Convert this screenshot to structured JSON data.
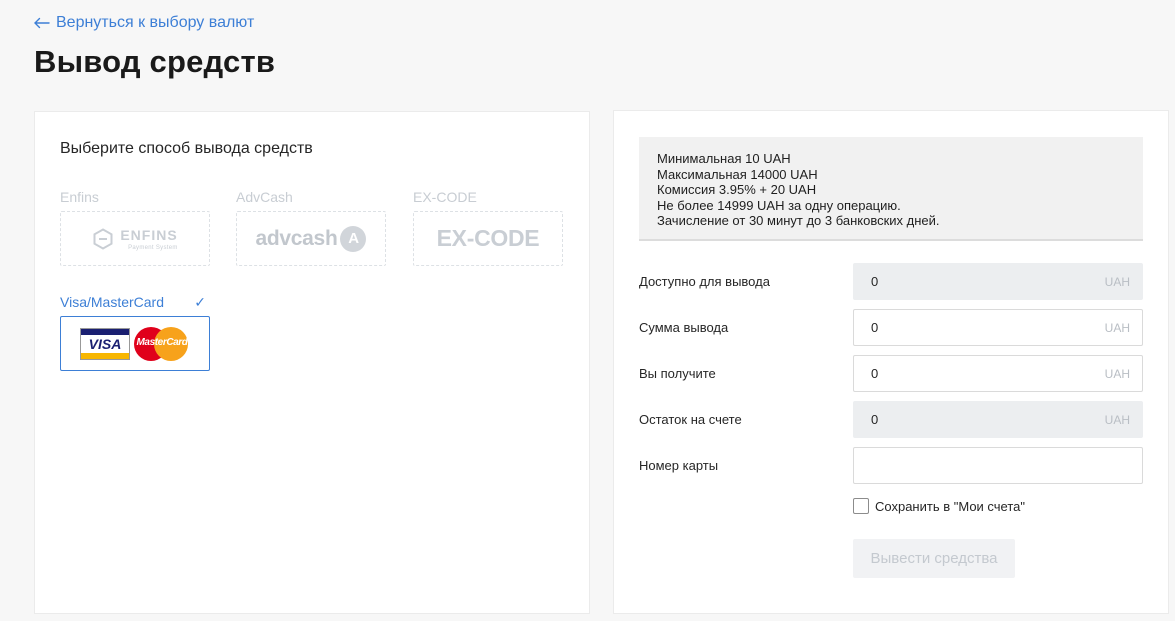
{
  "header": {
    "back_label": "Вернуться к выбору валют",
    "title": "Вывод средств"
  },
  "methods": {
    "heading": "Выберите способ вывода средств",
    "items": [
      {
        "label": "Enfins",
        "logo_text": "ENFINS",
        "logo_sub": "Payment System",
        "selected": false
      },
      {
        "label": "AdvCash",
        "logo_text": "advcash",
        "logo_symbol": "A",
        "selected": false
      },
      {
        "label": "EX-CODE",
        "logo_text": "EX-CODE",
        "selected": false
      },
      {
        "label": "Visa/MasterCard",
        "logo_visa": "VISA",
        "logo_mc": "MasterCard",
        "selected": true
      }
    ]
  },
  "info": {
    "lines": [
      "Минимальная 10 UAH",
      "Максимальная 14000 UAH",
      "Комиссия 3.95% + 20 UAH",
      "Не более 14999 UAH за одну операцию.",
      "Зачисление от 30 минут до 3 банковских дней."
    ]
  },
  "form": {
    "available": {
      "label": "Доступно для вывода",
      "value": "0",
      "currency": "UAH"
    },
    "amount": {
      "label": "Сумма вывода",
      "value": "0",
      "currency": "UAH"
    },
    "receive": {
      "label": "Вы получите",
      "value": "0",
      "currency": "UAH"
    },
    "balance": {
      "label": "Остаток на счете",
      "value": "0",
      "currency": "UAH"
    },
    "card": {
      "label": "Номер карты",
      "value": ""
    },
    "save_label": "Сохранить в \"Мои счета\"",
    "submit_label": "Вывести средства"
  },
  "colors": {
    "accent": "#3d7fd6",
    "disabled_text": "#c4c9cf"
  }
}
